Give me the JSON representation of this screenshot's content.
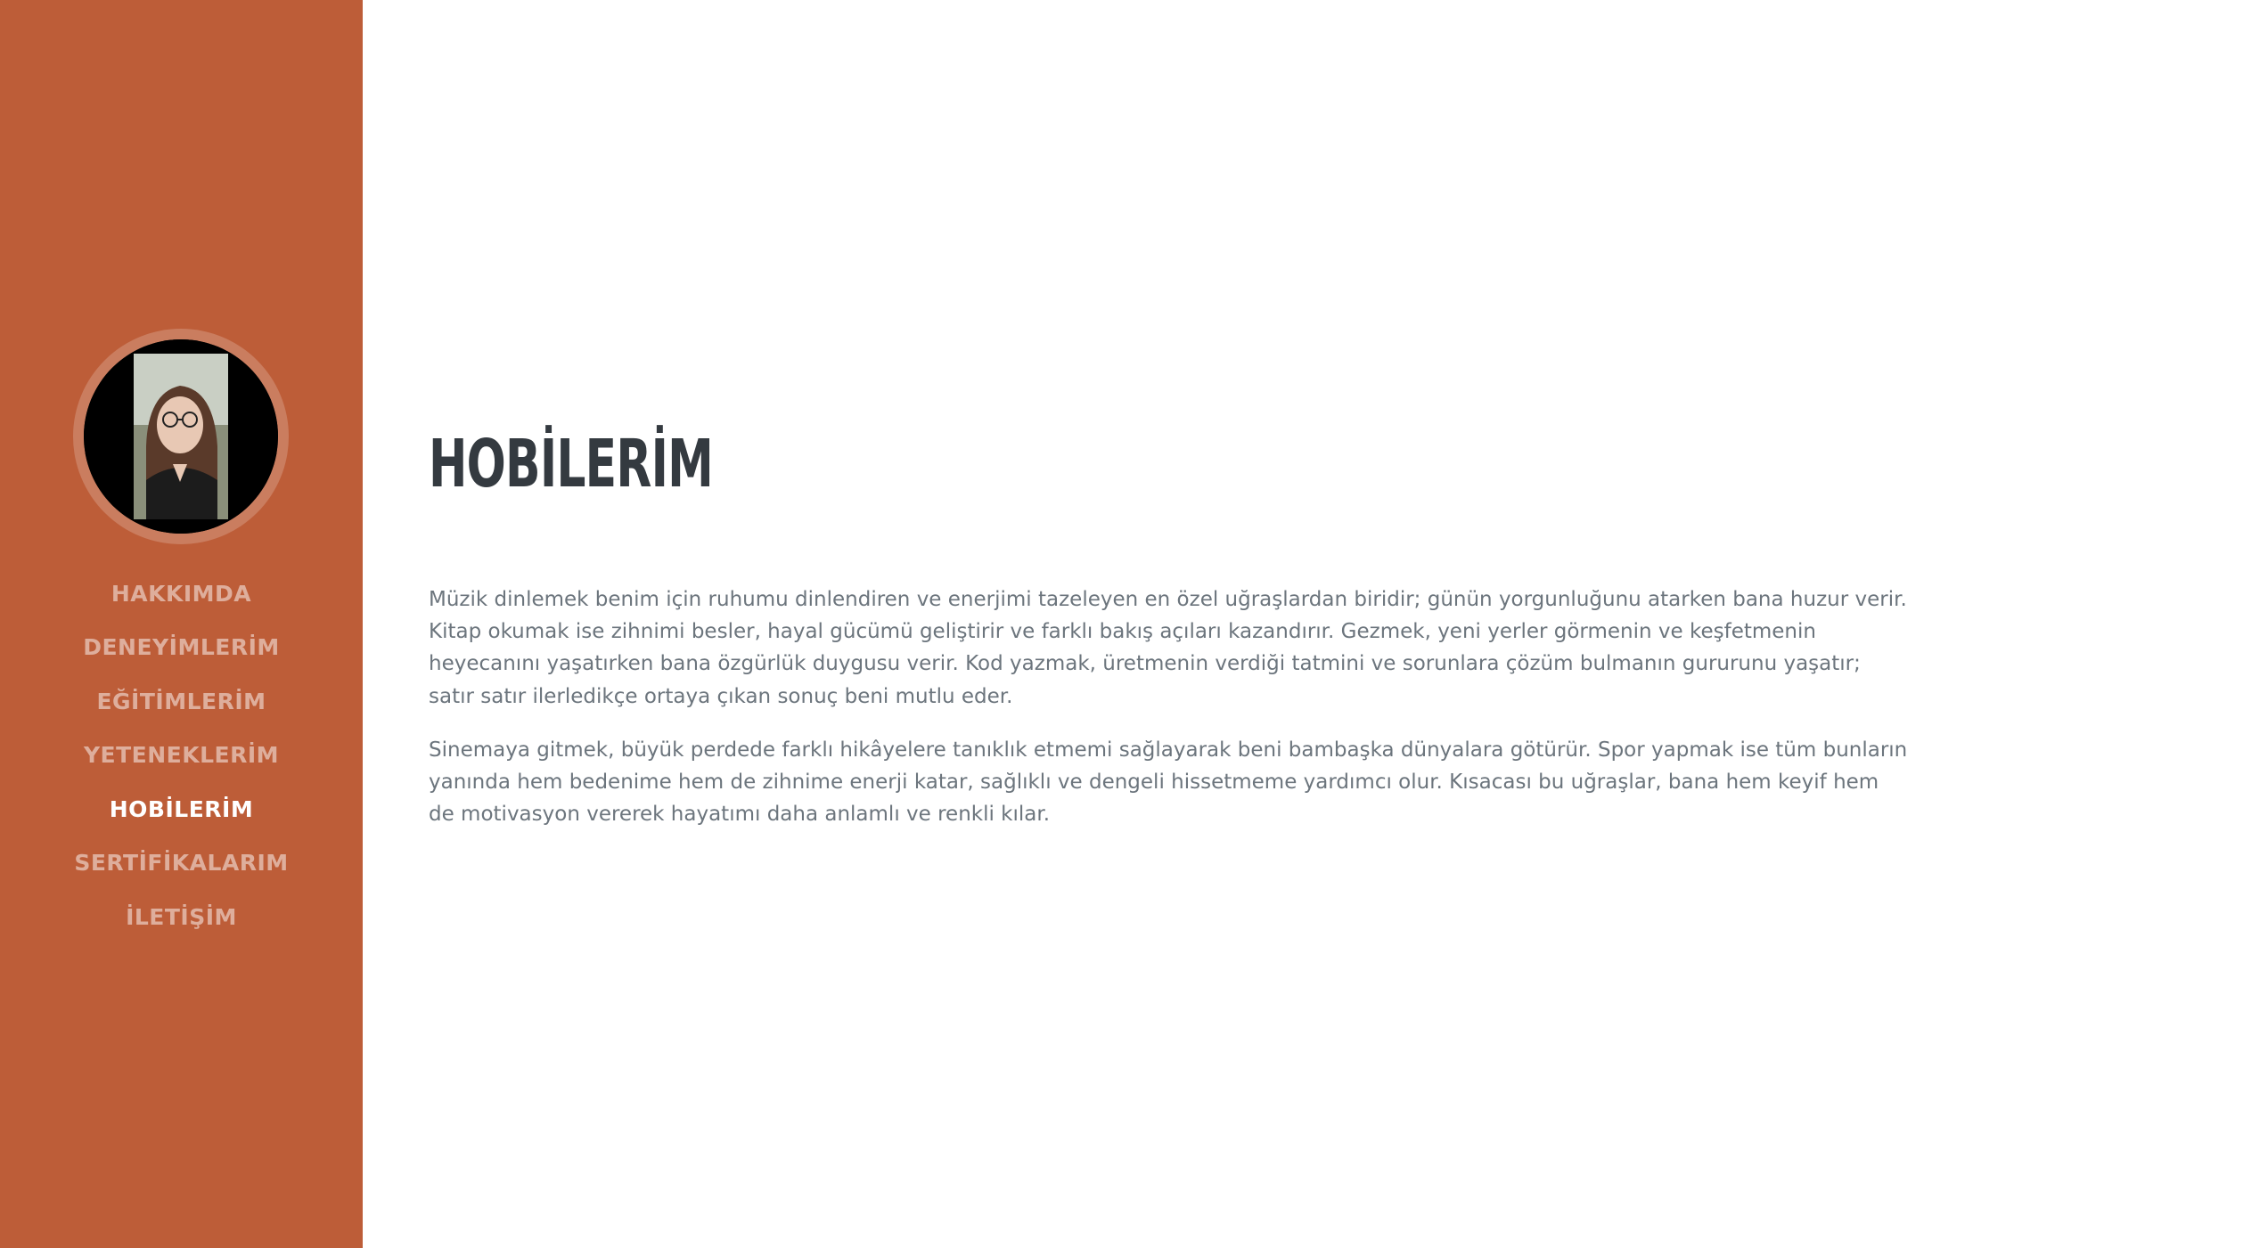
{
  "sidebar": {
    "avatar_alt": "profile photo",
    "nav": [
      {
        "label": "HAKKIMDA",
        "active": false
      },
      {
        "label": "DENEYİMLERİM",
        "active": false
      },
      {
        "label": "EĞİTİMLERİM",
        "active": false
      },
      {
        "label": "YETENEKLERİM",
        "active": false
      },
      {
        "label": "HOBİLERİM",
        "active": true
      },
      {
        "label": "SERTİFİKALARIM",
        "active": false
      },
      {
        "label": "İLETİŞİM",
        "active": false
      }
    ]
  },
  "main": {
    "title": "HOBİLERİM",
    "paragraphs": [
      "Müzik dinlemek benim için ruhumu dinlendiren ve enerjimi tazeleyen en özel uğraşlardan biridir; günün yorgunluğunu atarken bana huzur verir. Kitap okumak ise zihnimi besler, hayal gücümü geliştirir ve farklı bakış açıları kazandırır. Gezmek, yeni yerler görmenin ve keşfetmenin heyecanını yaşatırken bana özgürlük duygusu verir. Kod yazmak, üretmenin verdiği tatmini ve sorunlara çözüm bulmanın gururunu yaşatır; satır satır ilerledikçe ortaya çıkan sonuç beni mutlu eder.",
      "Sinemaya gitmek, büyük perdede farklı hikâyelere tanıklık etmemi sağlayarak beni bambaşka dünyalara götürür. Spor yapmak ise tüm bunların yanında hem bedenime hem de zihnime enerji katar, sağlıklı ve dengeli hissetmeme yardımcı olur. Kısacası bu uğraşlar, bana hem keyif hem de motivasyon vererek hayatımı daha anlamlı ve renkli kılar."
    ]
  },
  "colors": {
    "sidebar_bg": "#bd5d38",
    "title": "#343a40",
    "body_text": "#6c757d"
  }
}
